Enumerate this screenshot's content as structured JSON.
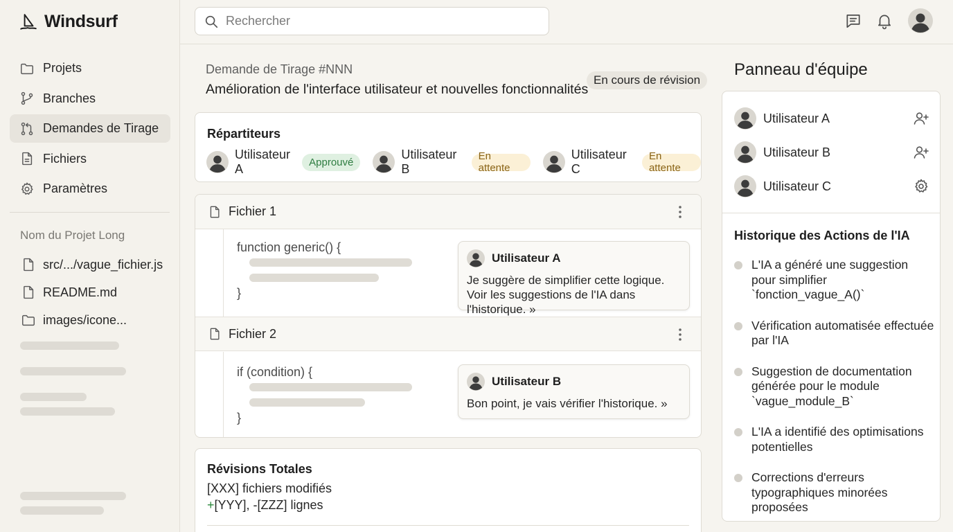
{
  "brand": {
    "title": "Windsurf",
    "icon": "sailboat-icon"
  },
  "sidebar": {
    "nav": [
      {
        "label": "Projets",
        "icon": "folder-icon"
      },
      {
        "label": "Branches",
        "icon": "git-branch-icon"
      },
      {
        "label": "Demandes de Tirage",
        "icon": "git-pull-request-icon",
        "active": true
      },
      {
        "label": "Fichiers",
        "icon": "file-icon"
      },
      {
        "label": "Paramètres",
        "icon": "gear-icon"
      }
    ],
    "project_name": "Nom du Projet Long",
    "files": [
      {
        "label": "src/.../vague_fichier.js",
        "icon": "file-icon"
      },
      {
        "label": "README.md",
        "icon": "file-icon"
      },
      {
        "label": "images/icone...",
        "icon": "folder-icon"
      }
    ]
  },
  "topbar": {
    "search_placeholder": "Rechercher",
    "icons": [
      "search-icon",
      "message-icon",
      "bell-icon",
      "avatar"
    ]
  },
  "pr": {
    "id": "Demande de Tirage #NNN",
    "title": "Amélioration de l'interface utilisateur et nouvelles fonctionnalités",
    "status": "En cours de révision"
  },
  "reviewers": {
    "heading": "Répartiteurs",
    "items": [
      {
        "name": "Utilisateur A",
        "status": "Approuvé",
        "status_color": "#2f7d42"
      },
      {
        "name": "Utilisateur B",
        "status": "En attente",
        "status_color": "#8a6417"
      },
      {
        "name": "Utilisateur C",
        "status": "En attente",
        "status_color": "#8a6417"
      }
    ]
  },
  "files": [
    {
      "title": "Fichier 1",
      "code_open": "function generic() {",
      "code_close": "}",
      "comment": {
        "author": "Utilisateur A",
        "text": "Je suggère de simplifier cette logique. Voir les suggestions de l'IA dans l'historique. »"
      }
    },
    {
      "title": "Fichier 2",
      "code_open": "if (condition) {",
      "code_close": "}",
      "comment": {
        "author": "Utilisateur B",
        "text": "Bon point, je vais vérifier l'historique. »"
      }
    }
  ],
  "revisions": {
    "heading": "Révisions Totales",
    "files_changed": "[XXX] fichiers modifiés",
    "plus": "+",
    "lines": "[YYY], -[ZZZ] lignes"
  },
  "team": {
    "title": "Panneau d'équipe",
    "members": [
      {
        "name": "Utilisateur A",
        "action_icon": "user-plus-icon"
      },
      {
        "name": "Utilisateur B",
        "action_icon": "user-plus-icon"
      },
      {
        "name": "Utilisateur C",
        "action_icon": "gear-icon"
      }
    ],
    "history_title": "Historique des Actions de l'IA",
    "history": [
      "L'IA a généré une suggestion pour simplifier `fonction_vague_A()`",
      "Vérification automatisée effectuée par l'IA",
      "Suggestion de documentation générée pour le module `vague_module_B`",
      "L'IA a identifié des optimisations potentielles",
      "Corrections d'erreurs typographiques minorées proposées"
    ]
  }
}
